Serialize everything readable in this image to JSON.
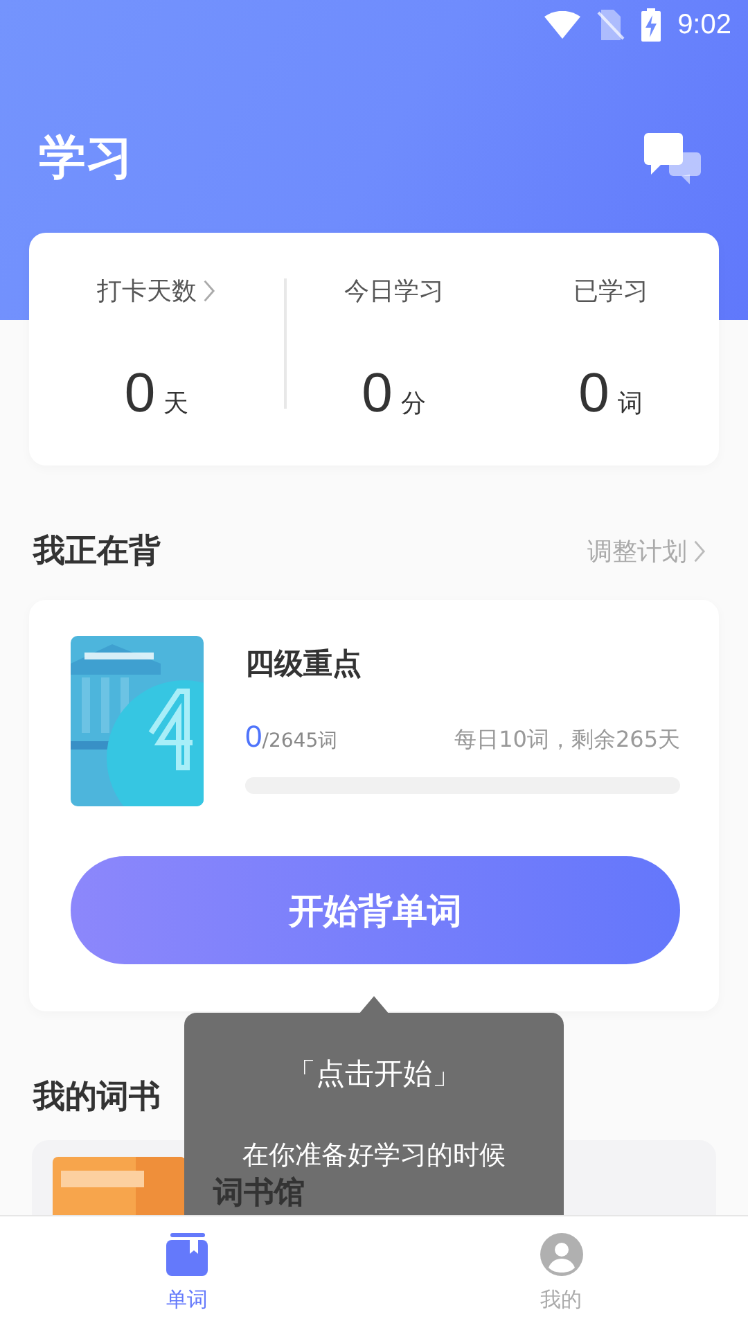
{
  "status_bar": {
    "time": "9:02"
  },
  "header": {
    "title": "学习"
  },
  "stats": [
    {
      "label": "打卡天数",
      "has_arrow": true,
      "value": "0",
      "unit": "天"
    },
    {
      "label": "今日学习",
      "has_arrow": false,
      "value": "0",
      "unit": "分"
    },
    {
      "label": "已学习",
      "has_arrow": false,
      "value": "0",
      "unit": "词"
    }
  ],
  "current": {
    "section_title": "我正在背",
    "action": "调整计划",
    "book": {
      "title": "四级重点",
      "learned": "0",
      "total": "/2645词",
      "plan": "每日10词，剩余265天",
      "level": 0
    },
    "button": "开始背单词"
  },
  "tooltip": {
    "title": "「点击开始」",
    "text": "在你准备好学习的时候"
  },
  "my_books": {
    "section_title": "我的词书",
    "item": "词书馆"
  },
  "tabs": [
    {
      "label": "单词",
      "kind": "book",
      "selected": true
    },
    {
      "label": "我的",
      "kind": "person",
      "selected": false
    }
  ]
}
